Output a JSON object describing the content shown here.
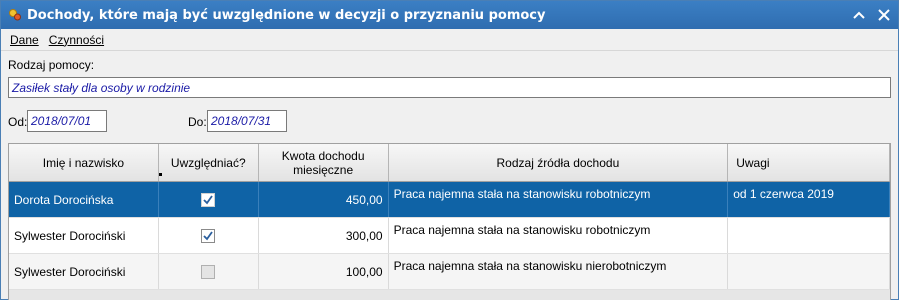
{
  "window": {
    "title": "Dochody, które mają być uwzględnione w decyzji o przyznaniu pomocy",
    "icons": {
      "app": "app-icon",
      "collapse": "chevron-up-icon",
      "close": "close-icon"
    }
  },
  "menu": {
    "items": [
      {
        "label": "Dane"
      },
      {
        "label": "Czynności"
      }
    ]
  },
  "form": {
    "rodzaj_label": "Rodzaj pomocy:",
    "rodzaj_value": "Zasiłek stały dla osoby w rodzinie",
    "od_label": "Od:",
    "od_value": "2018/07/01",
    "do_label": "Do:",
    "do_value": "2018/07/31"
  },
  "table": {
    "headers": [
      "Imię i nazwisko",
      "Uwzględniać?",
      "Kwota dochodu miesięczne",
      "Rodzaj źródła dochodu",
      "Uwagi"
    ],
    "rows": [
      {
        "name": "Dorota Dorocińska",
        "included": true,
        "amount": "450,00",
        "source": "Praca najemna stała na stanowisku robotniczym",
        "notes": "od 1 czerwca 2019",
        "selected": true
      },
      {
        "name": "Sylwester Dorociński",
        "included": true,
        "amount": "300,00",
        "source": "Praca najemna stała na stanowisku robotniczym",
        "notes": "",
        "selected": false
      },
      {
        "name": "Sylwester Dorociński",
        "included": false,
        "amount": "100,00",
        "source": "Praca najemna stała na stanowisku nierobotniczym",
        "notes": "",
        "selected": false
      }
    ]
  },
  "colors": {
    "titlebar": "#2f6db0",
    "selection": "#0f63a6",
    "field_text": "#1a1aa6"
  }
}
